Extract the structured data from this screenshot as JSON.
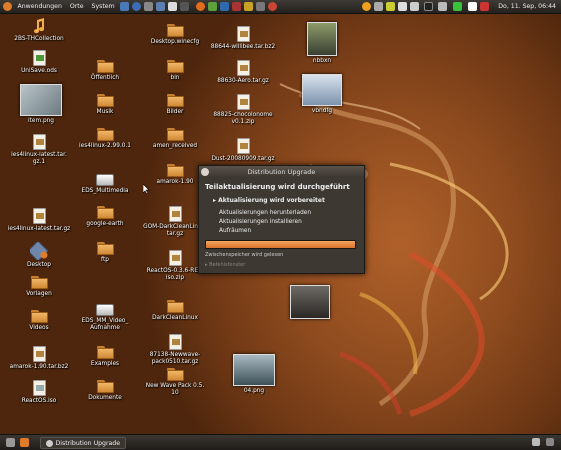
{
  "top_panel": {
    "menus": [
      "Anwendungen",
      "Orte",
      "System"
    ],
    "clock": "Do, 11. Sep, 06:44"
  },
  "desktop_icons": [
    {
      "label": "2BS-THCollection"
    },
    {
      "label": "UniSave.ods"
    },
    {
      "label": "item.png"
    },
    {
      "label": "ies4linux-latest.tar.\ngz.1"
    },
    {
      "label": "ies4linux-latest.tar.gz"
    },
    {
      "label": "Desktop"
    },
    {
      "label": "Vorlagen"
    },
    {
      "label": "Videos"
    },
    {
      "label": "amarok-1.90.tar.bz2"
    },
    {
      "label": "ReactOS.iso"
    },
    {
      "label": "Öffentlich"
    },
    {
      "label": "Musik"
    },
    {
      "label": "ies4linux-2.99.0.1"
    },
    {
      "label": "EDS_Multimedia"
    },
    {
      "label": "google-earth"
    },
    {
      "label": "ftp"
    },
    {
      "label": "EDS_MM_Video_\nAufnahme"
    },
    {
      "label": "Examples"
    },
    {
      "label": "Dokumente"
    },
    {
      "label": "Desktop.winecfg"
    },
    {
      "label": "bin"
    },
    {
      "label": "Bilder"
    },
    {
      "label": "amen_received"
    },
    {
      "label": "amarok-1.90"
    },
    {
      "label": "GOM-DarkCleanLinux.\ntar.gz"
    },
    {
      "label": "ReactOS-0.3.6-REL-\niso.zip"
    },
    {
      "label": "DarkCleanLinux"
    },
    {
      "label": "87138-Newwave-\npack0510.tar.gz"
    },
    {
      "label": "New Wave Pack 0.5.\n10"
    },
    {
      "label": "88644-willibee.tar.bz2"
    },
    {
      "label": "88630-Aero.tar.gz"
    },
    {
      "label": "88825-chocolonome\nv0.1.zip"
    },
    {
      "label": "Dust-20080909.tar.gz"
    },
    {
      "label": "nbbxn"
    },
    {
      "label": "vbndfg"
    },
    {
      "label": "04.png"
    }
  ],
  "dialog": {
    "title": "Distribution Upgrade",
    "heading": "Teilaktualisierung wird durchgeführt",
    "active_step": "Aktualisierung wird vorbereitet",
    "steps": [
      "Aktualisierungen herunterladen",
      "Aktualisierungen installieren",
      "Aufräumen"
    ],
    "progress": 1.0,
    "progress_text": "Zwischenspeicher wird gelesen",
    "details_label": "Befehlsfenster"
  },
  "taskbar": {
    "items": [
      "Distribution Upgrade"
    ]
  },
  "colors": {
    "progress": "#e58a3e",
    "folder": "#e9a653",
    "background": "#8e4b1e"
  }
}
